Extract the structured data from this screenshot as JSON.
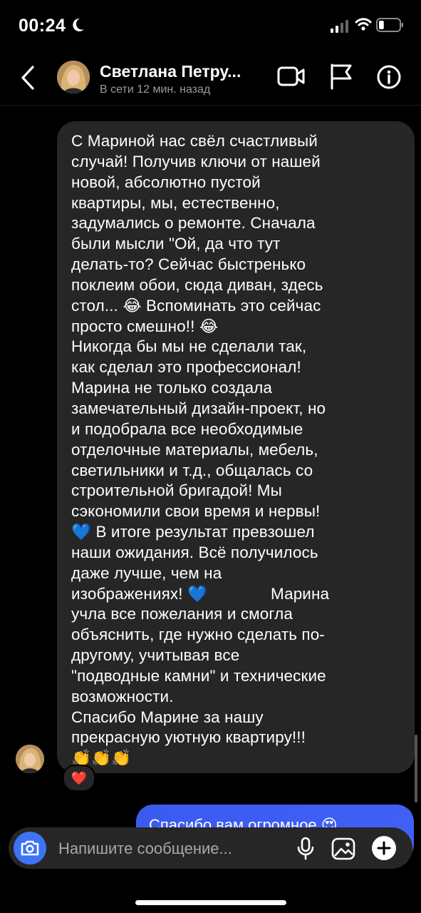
{
  "status_bar": {
    "time": "00:24",
    "battery_level": 0.25
  },
  "header": {
    "contact_name": "Светлана Петру...",
    "contact_status": "В сети 12 мин. назад"
  },
  "message": {
    "text": "С Мариной нас свёл счастливый\nслучай! Получив ключи от нашей\nновой, абсолютно пустой\nквартиры, мы, естественно,\nзадумались о ремонте. Сначала\nбыли мысли \"Ой, да что тут\nделать-то? Сейчас быстренько\nпоклеим обои, сюда диван, здесь\nстол... 😂 Вспоминать это сейчас\nпросто смешно!! 😂\nНикогда бы мы не сделали так,\nкак сделал это профессионал!\nМарина не только создала\nзамечательный дизайн-проект, но\nи подобрала все необходимые\nотделочные материалы, мебель,\nсветильники и т.д., общалась со\nстроительной бригадой! Мы\nсэкономили свои время и нервы!\n💙 В итоге результат превзошел\nнаши ожидания. Всё получилось\nдаже лучше, чем на\nизображениях! 💙              Марина\nучла все пожелания и смогла\nобъяснить, где нужно сделать по-\nдругому, учитывая все\n\"подводные камни\" и технические\nвозможности.\nСпасибо Марине за нашу\nпрекрасную уютную квартиру!!!\n👏👏👏",
    "reaction": "❤️"
  },
  "outgoing_message": {
    "text": "Спасибо вам огромное 😍"
  },
  "composer": {
    "placeholder": "Напишите сообщение..."
  },
  "icons": {
    "back": "chevron-left-icon",
    "video": "video-camera-icon",
    "flag": "flag-icon",
    "info": "info-icon",
    "camera": "camera-icon",
    "mic": "microphone-icon",
    "gallery": "gallery-icon",
    "plus": "plus-icon"
  },
  "colors": {
    "background": "#000000",
    "bubble_incoming": "#262626",
    "bubble_outgoing": "#3b5bf0",
    "camera_button": "#3d73f5"
  }
}
